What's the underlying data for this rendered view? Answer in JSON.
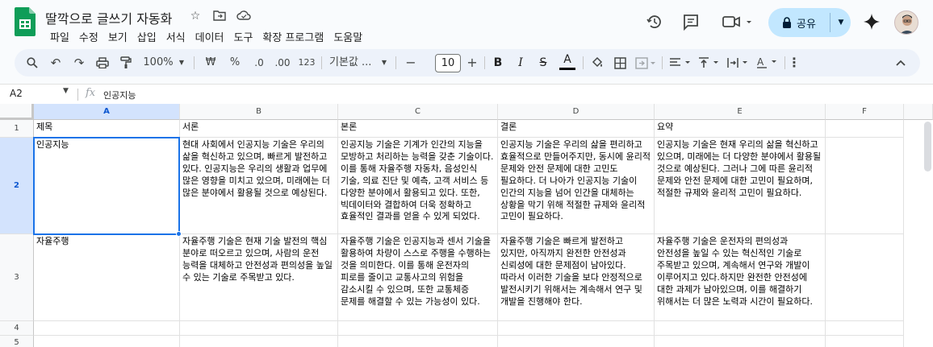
{
  "doc_title": "딸깍으로 글쓰기 자동화",
  "menu": [
    "파일",
    "수정",
    "보기",
    "삽입",
    "서식",
    "데이터",
    "도구",
    "확장 프로그램",
    "도움말"
  ],
  "share_label": "공유",
  "toolbar": {
    "zoom": "100%",
    "currency": "₩",
    "percent": "%",
    "dec_decrease": ".0",
    "dec_increase": ".00",
    "number_format": "123",
    "font": "기본값 ...",
    "font_size": "10",
    "minus": "−",
    "plus": "+",
    "bold": "B",
    "italic": "I",
    "strike": "S",
    "text_color": "A",
    "text_color_swatch": "#000000"
  },
  "formula_bar": {
    "cell_ref": "A2",
    "fx": "fx",
    "value": "인공지능"
  },
  "columns": [
    "A",
    "B",
    "C",
    "D",
    "E",
    "F"
  ],
  "rows": [
    "1",
    "2",
    "3",
    "4",
    "5"
  ],
  "cells": {
    "A1": "제목",
    "B1": "서론",
    "C1": "본론",
    "D1": "결론",
    "E1": "요약",
    "A2": "인공지능",
    "B2": "현대 사회에서 인공지능 기술은 우리의 삶을 혁신하고 있으며, 빠르게 발전하고 있다. 인공지능은 우리의 생활과 업무에 많은 영향을 미치고 있으며, 미래에는 더 많은 분야에서 활용될 것으로 예상된다.",
    "C2": "인공지능 기술은 기계가 인간의 지능을 모방하고 처리하는 능력을 갖춘 기술이다. 이를 통해 자율주행 자동차, 음성인식 기술, 의료 진단 및 예측, 고객 서비스 등 다양한 분야에서 활용되고 있다. 또한, 빅데이터와 결합하여 더욱 정확하고 효율적인 결과를 얻을 수 있게 되었다.",
    "D2": "인공지능 기술은 우리의 삶을 편리하고 효율적으로 만들어주지만, 동시에 윤리적 문제와 안전 문제에 대한 고민도 필요하다. 더 나아가 인공지능 기술이 인간의 지능을 넘어 인간을 대체하는 상황을 막기 위해 적절한 규제와 윤리적 고민이 필요하다.",
    "E2": "인공지능 기술은 현재 우리의 삶을 혁신하고 있으며, 미래에는 더 다양한 분야에서 활용될 것으로 예상된다. 그러나 그에 따른 윤리적 문제와 안전 문제에 대한 고민이 필요하며, 적절한 규제와 윤리적 고민이 필요하다.",
    "A3": "자율주행",
    "B3": "자율주행 기술은 현재 기술 발전의 핵심 분야로 떠오르고 있으며, 사람의 운전 능력을 대체하고 안전성과 편의성을 높일 수 있는 기술로 주목받고 있다.",
    "C3": "자율주행 기술은 인공지능과 센서 기술을 활용하여 차량이 스스로 주행을 수행하는 것을 의미한다. 이를 통해 운전자의 피로를 줄이고 교통사고의 위험을 감소시킬 수 있으며, 또한 교통체증 문제를 해결할 수 있는 가능성이 있다.",
    "D3": "자율주행 기술은 빠르게 발전하고 있지만, 아직까지 완전한 안전성과 신뢰성에 대한 문제점이 남아있다. 따라서 이러한 기술을 보다 안정적으로 발전시키기 위해서는 계속해서 연구 및 개발을 진행해야 한다.",
    "E3": "자율주행 기술은 운전자의 편의성과 안전성을 높일 수 있는 혁신적인 기술로 주목받고 있으며, 계속해서 연구와 개발이 이루어지고 있다.하지만 완전한 안전성에 대한 과제가 남아있으며, 이를 해결하기 위해서는 더 많은 노력과 시간이 필요하다."
  }
}
